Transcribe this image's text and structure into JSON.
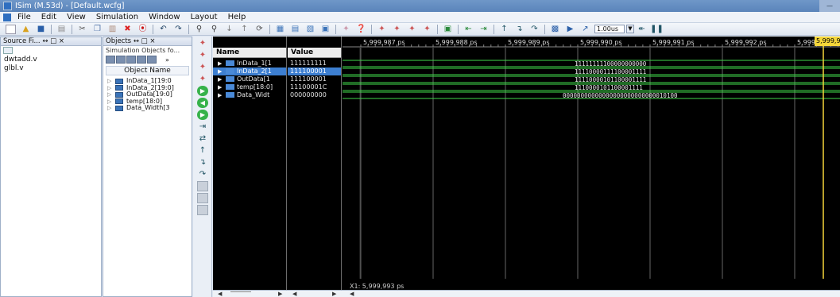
{
  "window": {
    "title": "ISim (M.53d) - [Default.wcfg]"
  },
  "menu": [
    "File",
    "Edit",
    "View",
    "Simulation",
    "Window",
    "Layout",
    "Help"
  ],
  "toolbar": {
    "zoom_value": "1.00us"
  },
  "source_panel": {
    "title": "Source Fi... ↔ □ ×",
    "files": [
      "dwtadd.v",
      "glbl.v"
    ]
  },
  "objects_panel": {
    "title": "Objects     ↔ □ ×",
    "subtitle": "Simulation Objects fo...",
    "more": "»",
    "column": "Object Name",
    "items": [
      "InData_1[19:0",
      "InData_2[19:0]",
      "OutData[19:0]",
      "temp[18:0]",
      "Data_Width[3"
    ]
  },
  "wave": {
    "name_header": "Name",
    "value_header": "Value",
    "signals": [
      {
        "name": "InData_1[1",
        "value": "111111111",
        "selected": false
      },
      {
        "name": "InData_2[1",
        "value": "111100001",
        "selected": true
      },
      {
        "name": "OutData[1",
        "value": "111100001",
        "selected": false
      },
      {
        "name": "temp[18:0]",
        "value": "11100001C",
        "selected": false
      },
      {
        "name": "Data_Widt",
        "value": "000000000",
        "selected": false
      }
    ],
    "ticks": [
      "5,999,987 ps",
      "5,999,988 ps",
      "5,999,989 ps",
      "5,999,990 ps",
      "5,999,991 ps",
      "5,999,992 ps",
      "5,999,993 p"
    ],
    "bus_values": [
      "11111111100000000000",
      "11110000111100001111",
      "11110000101100001111",
      "1110000101100001111",
      "00000000000000000000000000010100"
    ],
    "cursor_time": "5,999,993 p",
    "cursor_label": "X1: 5,999,993 ps",
    "colors": {
      "signal_green": "#3fd84a",
      "cursor_yellow": "#f5d63a",
      "selection": "#3d7fd1"
    }
  }
}
